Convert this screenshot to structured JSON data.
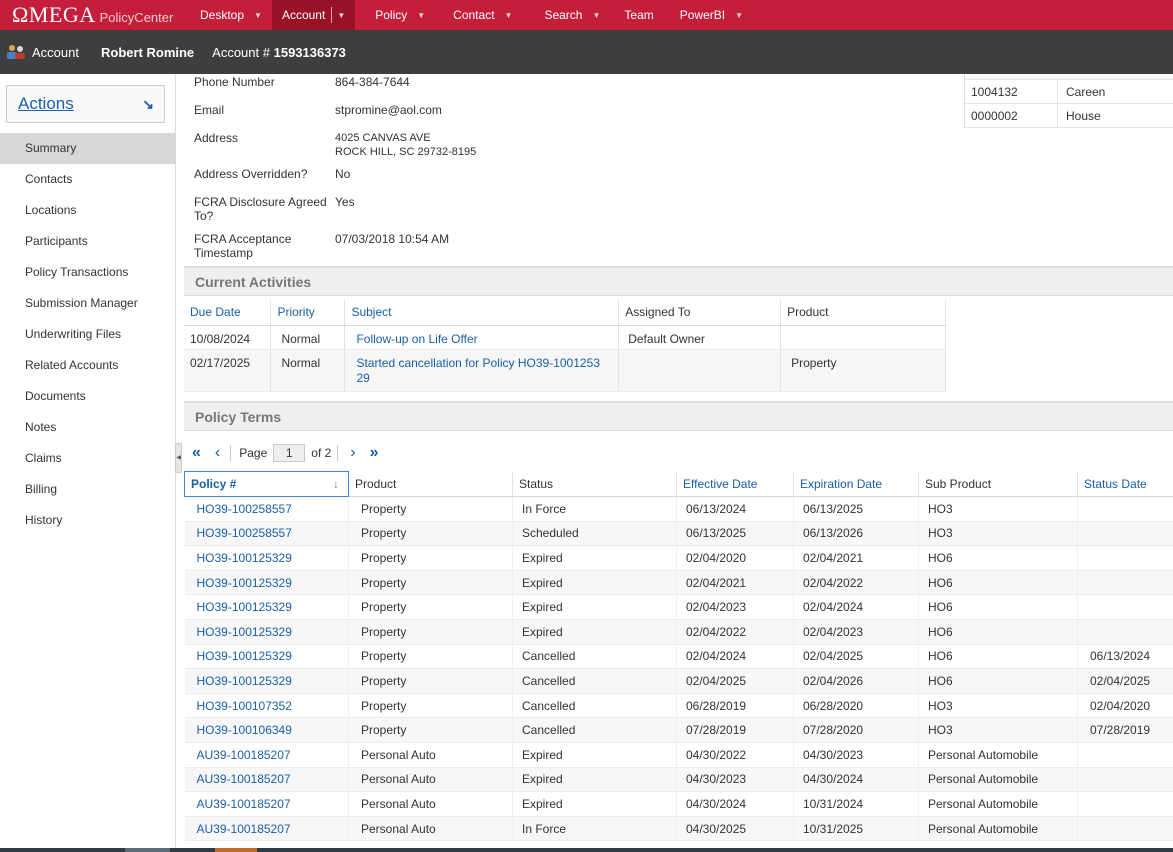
{
  "app": {
    "logo_omega": "ΩMEGA",
    "logo_product": "PolicyCenter"
  },
  "nav": [
    {
      "label": "Desktop"
    },
    {
      "label": "Account"
    },
    {
      "label": "Policy"
    },
    {
      "label": "Contact"
    },
    {
      "label": "Search"
    },
    {
      "label": "Team"
    },
    {
      "label": "PowerBI"
    }
  ],
  "account_bar": {
    "label": "Account",
    "name": "Robert Romine",
    "number_label": "Account #",
    "number": "1593136373"
  },
  "sidebar": {
    "actions_label": "Actions",
    "actions_arrow": "↘",
    "items": [
      {
        "label": "Summary",
        "active": true
      },
      {
        "label": "Contacts"
      },
      {
        "label": "Locations"
      },
      {
        "label": "Participants"
      },
      {
        "label": "Policy Transactions"
      },
      {
        "label": "Submission Manager"
      },
      {
        "label": "Underwriting Files"
      },
      {
        "label": "Related Accounts"
      },
      {
        "label": "Documents"
      },
      {
        "label": "Notes"
      },
      {
        "label": "Claims"
      },
      {
        "label": "Billing"
      },
      {
        "label": "History"
      }
    ]
  },
  "account_info": {
    "phone_label": "Phone Number",
    "phone": "864-384-7644",
    "email_label": "Email",
    "email": "stpromine@aol.com",
    "address_label": "Address",
    "address_line1": "4025 CANVAS AVE",
    "address_line2": "ROCK HILL, SC 29732-8195",
    "address_overridden_label": "Address Overridden?",
    "address_overridden": "No",
    "fcra_label_1": "FCRA Disclosure Agreed",
    "fcra_label_2": "To?",
    "fcra": "Yes",
    "fcra_ts_label_1": "FCRA Acceptance",
    "fcra_ts_label_2": "Timestamp",
    "fcra_ts": "07/03/2018 10:54 AM"
  },
  "producer_codes": [
    {
      "code": "1004132",
      "name": "Careen"
    },
    {
      "code": "0000002",
      "name": "House"
    }
  ],
  "current_activities": {
    "title": "Current Activities",
    "columns": [
      "Due Date",
      "Priority",
      "Subject",
      "Assigned To",
      "Product"
    ],
    "rows": [
      {
        "due": "10/08/2024",
        "priority": "Normal",
        "subject": "Follow-up on Life Offer",
        "assigned": "Default Owner",
        "product": ""
      },
      {
        "due": "02/17/2025",
        "priority": "Normal",
        "subject_1": "Started cancellation for Policy HO39-1001253",
        "subject_2": "29",
        "assigned": "",
        "product": "Property"
      }
    ]
  },
  "policy_terms": {
    "title": "Policy Terms",
    "pager": {
      "page_label": "Page",
      "page": "1",
      "of": "of 2"
    },
    "columns": [
      "Policy #",
      "Product",
      "Status",
      "Effective Date",
      "Expiration Date",
      "Sub Product",
      "Status Date"
    ],
    "rows": [
      [
        "HO39-100258557",
        "Property",
        "In Force",
        "06/13/2024",
        "06/13/2025",
        "HO3",
        ""
      ],
      [
        "HO39-100258557",
        "Property",
        "Scheduled",
        "06/13/2025",
        "06/13/2026",
        "HO3",
        ""
      ],
      [
        "HO39-100125329",
        "Property",
        "Expired",
        "02/04/2020",
        "02/04/2021",
        "HO6",
        ""
      ],
      [
        "HO39-100125329",
        "Property",
        "Expired",
        "02/04/2021",
        "02/04/2022",
        "HO6",
        ""
      ],
      [
        "HO39-100125329",
        "Property",
        "Expired",
        "02/04/2023",
        "02/04/2024",
        "HO6",
        ""
      ],
      [
        "HO39-100125329",
        "Property",
        "Expired",
        "02/04/2022",
        "02/04/2023",
        "HO6",
        ""
      ],
      [
        "HO39-100125329",
        "Property",
        "Cancelled",
        "02/04/2024",
        "02/04/2025",
        "HO6",
        "06/13/2024"
      ],
      [
        "HO39-100125329",
        "Property",
        "Cancelled",
        "02/04/2025",
        "02/04/2026",
        "HO6",
        "02/04/2025"
      ],
      [
        "HO39-100107352",
        "Property",
        "Cancelled",
        "06/28/2019",
        "06/28/2020",
        "HO3",
        "02/04/2020"
      ],
      [
        "HO39-100106349",
        "Property",
        "Cancelled",
        "07/28/2019",
        "07/28/2020",
        "HO3",
        "07/28/2019"
      ],
      [
        "AU39-100185207",
        "Personal Auto",
        "Expired",
        "04/30/2022",
        "04/30/2023",
        "Personal Automobile",
        ""
      ],
      [
        "AU39-100185207",
        "Personal Auto",
        "Expired",
        "04/30/2023",
        "04/30/2024",
        "Personal Automobile",
        ""
      ],
      [
        "AU39-100185207",
        "Personal Auto",
        "Expired",
        "04/30/2024",
        "10/31/2024",
        "Personal Automobile",
        ""
      ],
      [
        "AU39-100185207",
        "Personal Auto",
        "In Force",
        "04/30/2025",
        "10/31/2025",
        "Personal Automobile",
        ""
      ]
    ]
  },
  "colors": {
    "brand_red": "#c41e3a",
    "account_bar": "#3e3e3e",
    "link_blue": "#1a5fa8"
  }
}
